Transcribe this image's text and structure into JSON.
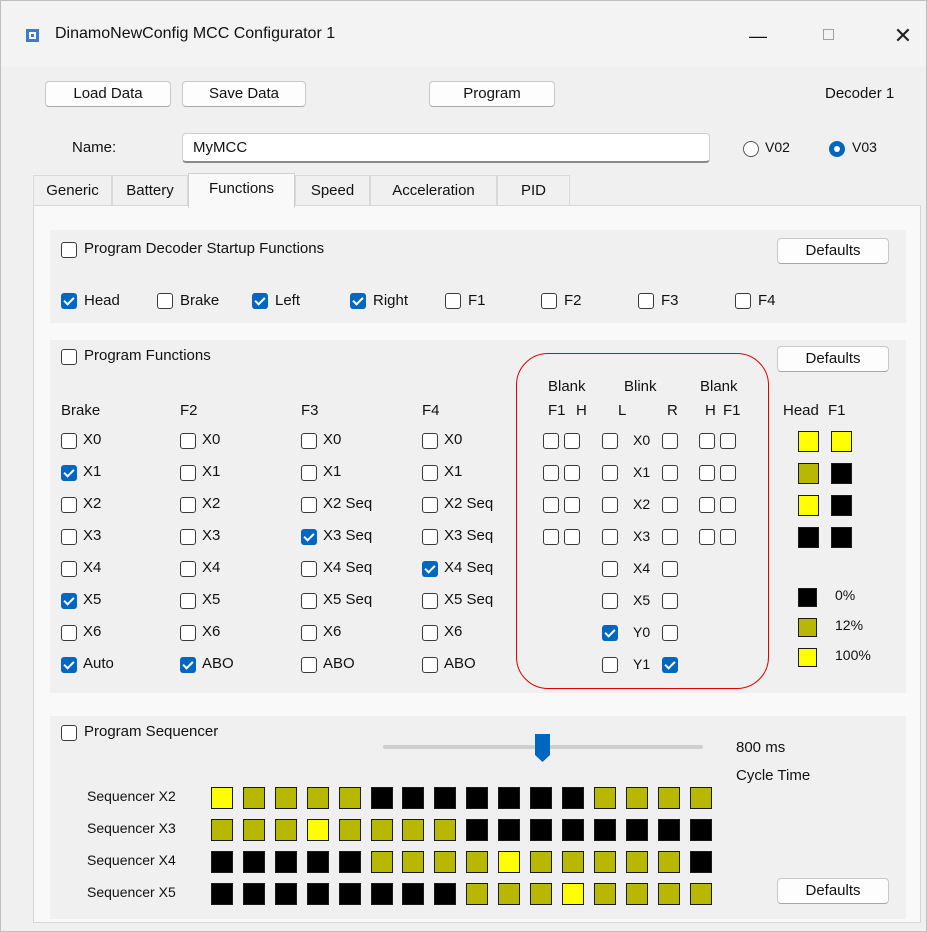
{
  "window": {
    "title": "DinamoNewConfig MCC Configurator 1",
    "minimize": "—",
    "close": "✕"
  },
  "toolbar": {
    "load": "Load Data",
    "save": "Save Data",
    "program": "Program",
    "decoder": "Decoder 1"
  },
  "name": {
    "label": "Name:",
    "value": "MyMCC"
  },
  "version": {
    "options": [
      {
        "label": "V02",
        "selected": false
      },
      {
        "label": "V03",
        "selected": true
      }
    ]
  },
  "tabs": [
    "Generic",
    "Battery",
    "Functions",
    "Speed",
    "Acceleration",
    "PID"
  ],
  "active_tab": "Functions",
  "startup": {
    "title": "Program Decoder Startup Functions",
    "checked": false,
    "defaults": "Defaults",
    "items": [
      {
        "label": "Head",
        "checked": true
      },
      {
        "label": "Brake",
        "checked": false
      },
      {
        "label": "Left",
        "checked": true
      },
      {
        "label": "Right",
        "checked": true
      },
      {
        "label": "F1",
        "checked": false
      },
      {
        "label": "F2",
        "checked": false
      },
      {
        "label": "F3",
        "checked": false
      },
      {
        "label": "F4",
        "checked": false
      }
    ]
  },
  "functions": {
    "title": "Program Functions",
    "checked": false,
    "defaults": "Defaults",
    "columns": [
      {
        "header": "Brake",
        "items": [
          {
            "label": "X0",
            "checked": false
          },
          {
            "label": "X1",
            "checked": true
          },
          {
            "label": "X2",
            "checked": false
          },
          {
            "label": "X3",
            "checked": false
          },
          {
            "label": "X4",
            "checked": false
          },
          {
            "label": "X5",
            "checked": true
          },
          {
            "label": "X6",
            "checked": false
          },
          {
            "label": "Auto",
            "checked": true
          }
        ]
      },
      {
        "header": "F2",
        "items": [
          {
            "label": "X0",
            "checked": false
          },
          {
            "label": "X1",
            "checked": false
          },
          {
            "label": "X2",
            "checked": false
          },
          {
            "label": "X3",
            "checked": false
          },
          {
            "label": "X4",
            "checked": false
          },
          {
            "label": "X5",
            "checked": false
          },
          {
            "label": "X6",
            "checked": false
          },
          {
            "label": "ABO",
            "checked": true
          }
        ]
      },
      {
        "header": "F3",
        "items": [
          {
            "label": "X0",
            "checked": false
          },
          {
            "label": "X1",
            "checked": false
          },
          {
            "label": "X2 Seq",
            "checked": false
          },
          {
            "label": "X3 Seq",
            "checked": true
          },
          {
            "label": "X4 Seq",
            "checked": false
          },
          {
            "label": "X5 Seq",
            "checked": false
          },
          {
            "label": "X6",
            "checked": false
          },
          {
            "label": "ABO",
            "checked": false
          }
        ]
      },
      {
        "header": "F4",
        "items": [
          {
            "label": "X0",
            "checked": false
          },
          {
            "label": "X1",
            "checked": false
          },
          {
            "label": "X2 Seq",
            "checked": false
          },
          {
            "label": "X3 Seq",
            "checked": false
          },
          {
            "label": "X4 Seq",
            "checked": true
          },
          {
            "label": "X5 Seq",
            "checked": false
          },
          {
            "label": "X6",
            "checked": false
          },
          {
            "label": "ABO",
            "checked": false
          }
        ]
      }
    ],
    "blank_left": {
      "top": "Blank",
      "sub1": "F1",
      "sub2": "H"
    },
    "blink": {
      "top": "Blink",
      "sub1": "L",
      "sub2": "R"
    },
    "blank_right": {
      "top": "Blank",
      "sub1": "H",
      "sub2": "F1"
    },
    "blink_rows": [
      {
        "label": "X0",
        "blank_f1": false,
        "blank_h": false,
        "l": false,
        "r": false,
        "blank_h2": false,
        "blank_f1_2": false
      },
      {
        "label": "X1",
        "blank_f1": false,
        "blank_h": false,
        "l": false,
        "r": false,
        "blank_h2": false,
        "blank_f1_2": false
      },
      {
        "label": "X2",
        "blank_f1": false,
        "blank_h": false,
        "l": false,
        "r": false,
        "blank_h2": false,
        "blank_f1_2": false
      },
      {
        "label": "X3",
        "blank_f1": false,
        "blank_h": false,
        "l": false,
        "r": false,
        "blank_h2": false,
        "blank_f1_2": false
      },
      {
        "label": "X4",
        "l": false,
        "r": false
      },
      {
        "label": "X5",
        "l": false,
        "r": false
      },
      {
        "label": "Y0",
        "l": true,
        "r": false
      },
      {
        "label": "Y1",
        "l": false,
        "r": true
      }
    ],
    "brightness": {
      "headers": [
        "Head",
        "F1"
      ],
      "rows": [
        [
          "#ffff00",
          "#ffff00"
        ],
        [
          "#b8b800",
          "#000000"
        ],
        [
          "#ffff00",
          "#000000"
        ],
        [
          "#000000",
          "#000000"
        ]
      ]
    },
    "legend": [
      {
        "color": "#000000",
        "label": "0%"
      },
      {
        "color": "#b8b800",
        "label": "12%"
      },
      {
        "color": "#ffff00",
        "label": "100%"
      }
    ]
  },
  "sequencer": {
    "title": "Program Sequencer",
    "checked": false,
    "cycle_value": "800 ms",
    "cycle_label": "Cycle Time",
    "defaults": "Defaults",
    "rows": [
      {
        "label": "Sequencer X2",
        "cells": [
          "Y",
          "D",
          "D",
          "D",
          "D",
          "B",
          "B",
          "B",
          "B",
          "B",
          "B",
          "B",
          "D",
          "D",
          "D",
          "D"
        ]
      },
      {
        "label": "Sequencer X3",
        "cells": [
          "D",
          "D",
          "D",
          "Y",
          "D",
          "D",
          "D",
          "D",
          "B",
          "B",
          "B",
          "B",
          "B",
          "B",
          "B",
          "B"
        ]
      },
      {
        "label": "Sequencer X4",
        "cells": [
          "B",
          "B",
          "B",
          "B",
          "B",
          "D",
          "D",
          "D",
          "D",
          "Y",
          "D",
          "D",
          "D",
          "D",
          "D",
          "B"
        ]
      },
      {
        "label": "Sequencer X5",
        "cells": [
          "B",
          "B",
          "B",
          "B",
          "B",
          "B",
          "B",
          "B",
          "D",
          "D",
          "D",
          "Y",
          "D",
          "D",
          "D",
          "D"
        ]
      }
    ],
    "palette": {
      "B": "#000000",
      "D": "#b8b800",
      "Y": "#ffff00"
    }
  }
}
